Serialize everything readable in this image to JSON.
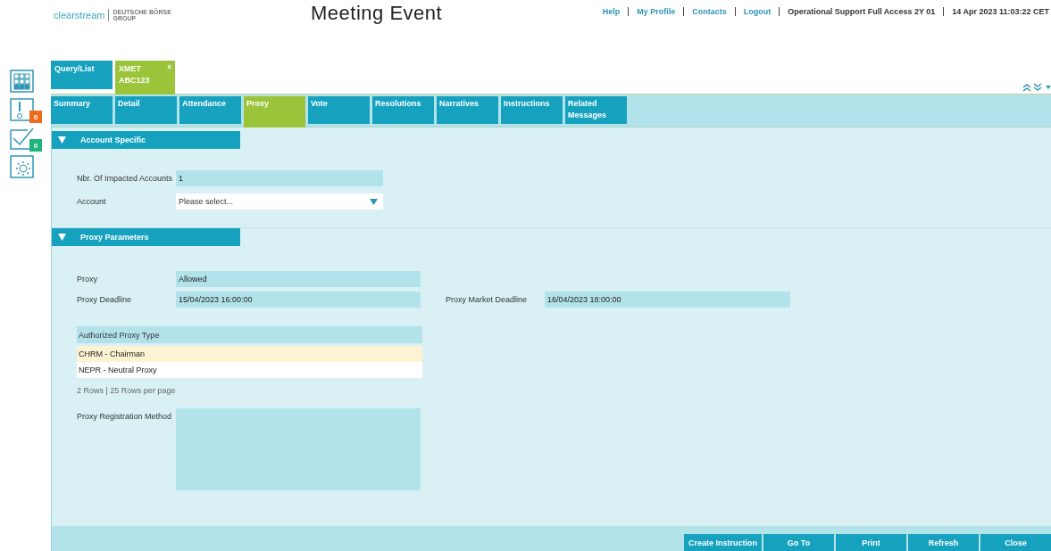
{
  "header": {
    "logo": {
      "brand": "clearstream",
      "group_lines": [
        "DEUTSCHE BÖRSE",
        "GROUP"
      ]
    },
    "title": "Meeting Event",
    "links": [
      "Help",
      "My Profile",
      "Contacts",
      "Logout"
    ],
    "user": "Operational Support Full Access 2Y 01",
    "datetime": "14 Apr 2023 11:03:22 CET"
  },
  "sidebar": [
    {
      "kind": "grid"
    },
    {
      "kind": "alert",
      "badge": "0",
      "color": "#ee6a1f"
    },
    {
      "kind": "tasks",
      "badge": "0",
      "color": "#1fb37d"
    },
    {
      "kind": "settings"
    }
  ],
  "doc_tabs": [
    {
      "lines": [
        "Query/List"
      ],
      "selected": false
    },
    {
      "lines": [
        "XMET",
        "ABC123"
      ],
      "selected": true,
      "close": "x"
    }
  ],
  "tabs": [
    {
      "lines": [
        "Summary"
      ],
      "selected": false
    },
    {
      "lines": [
        "Detail"
      ],
      "selected": false
    },
    {
      "lines": [
        "Attendance"
      ],
      "selected": false
    },
    {
      "lines": [
        "Proxy"
      ],
      "selected": true
    },
    {
      "lines": [
        "Vote"
      ],
      "selected": false
    },
    {
      "lines": [
        "Resolutions"
      ],
      "selected": false
    },
    {
      "lines": [
        "Narratives"
      ],
      "selected": false
    },
    {
      "lines": [
        "Instructions"
      ],
      "selected": false
    },
    {
      "lines": [
        "Related",
        "Messages"
      ],
      "selected": false
    }
  ],
  "account_section": {
    "title": "Account Specific",
    "expanded": true,
    "impacted": {
      "label": "Nbr. Of Impacted Accounts",
      "value": "1"
    },
    "account": {
      "label": "Account",
      "placeholder": "Please select..."
    }
  },
  "proxy_section": {
    "title": "Proxy Parameters",
    "expanded": true,
    "proxy": {
      "label": "Proxy",
      "value": "Allowed"
    },
    "deadline": {
      "label": "Proxy Deadline",
      "value": "15/04/2023 16:00:00"
    },
    "market_deadline": {
      "label": "Proxy Market Deadline",
      "value": "16/04/2023 18:00:00"
    },
    "table": {
      "column": "Authorized Proxy Type",
      "rows": [
        {
          "text": "CHRM - Chairman",
          "selected": true
        },
        {
          "text": "NEPR - Neutral Proxy",
          "selected": false
        }
      ]
    },
    "pager": "2 Rows | 25 Rows per page",
    "registration": {
      "label": "Proxy Registration Method"
    }
  },
  "footer_buttons": [
    "Create Instruction",
    "Go To",
    "Print",
    "Refresh",
    "Close"
  ]
}
